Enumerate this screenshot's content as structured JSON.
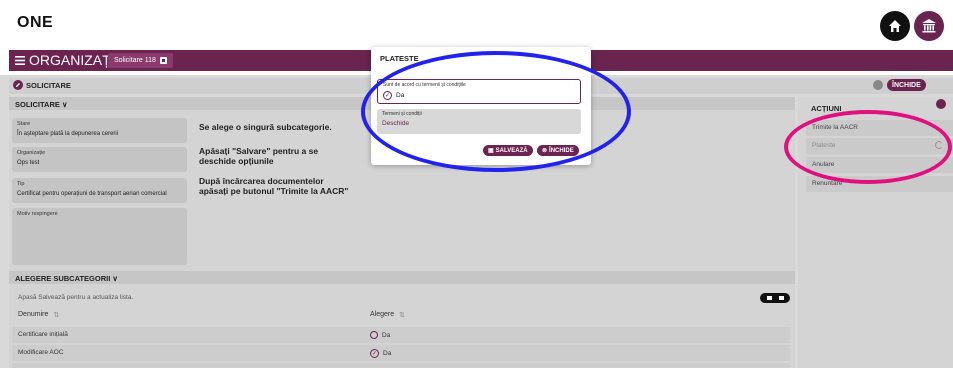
{
  "header": {
    "logo": "ONE",
    "home_icon": "home-icon",
    "institution_icon": "bank-icon"
  },
  "orgbar": {
    "title": "ORGANIZAȚII",
    "chip": "Solicitare 118"
  },
  "strip": {
    "label": "SOLICITARE",
    "close_label": "ÎNCHIDE"
  },
  "request": {
    "section_label": "SOLICITARE",
    "fields": [
      {
        "label": "Stare",
        "value": "În așteptare plată la depunerea cererii"
      },
      {
        "label": "Organizație",
        "value": "Ops test"
      },
      {
        "label": "Tip",
        "value": "Certificat pentru operațiuni de transport aerian comercial"
      },
      {
        "label": "Motiv respingere",
        "value": ""
      }
    ],
    "instructions": [
      "Se alege o singură subcategorie.",
      "Apăsați \"Salvare\" pentru a se deschide opțiunile",
      "După încărcarea documentelor apăsați pe butonul \"Trimite la AACR\""
    ]
  },
  "subcategories": {
    "section_label": "ALEGERE SUBCATEGORII",
    "hint": "Apasă Salvează pentru a actualiza lista.",
    "columns": [
      "Denumire",
      "Alegere"
    ],
    "rows": [
      {
        "name": "Certificare inițială",
        "choice": "Da",
        "checked": false
      },
      {
        "name": "Modificare AOC",
        "choice": "Da",
        "checked": true
      }
    ]
  },
  "actions": {
    "title": "ACȚIUNI",
    "items": [
      "Trimite la AACR",
      "Plateste",
      "Anulare",
      "Renuntare"
    ]
  },
  "modal": {
    "title": "PLATESTE",
    "field1_label": "Sunt de acord cu termenii și condițiile",
    "field1_value": "Da",
    "field2_label": "Termeni și condiții",
    "field2_value": "Deschide",
    "save_label": "SALVEAZĂ",
    "close_label": "ÎNCHIDE"
  },
  "colors": {
    "brand": "#6b2350",
    "annotation_blue": "#2222ee",
    "annotation_pink": "#e0107f"
  }
}
